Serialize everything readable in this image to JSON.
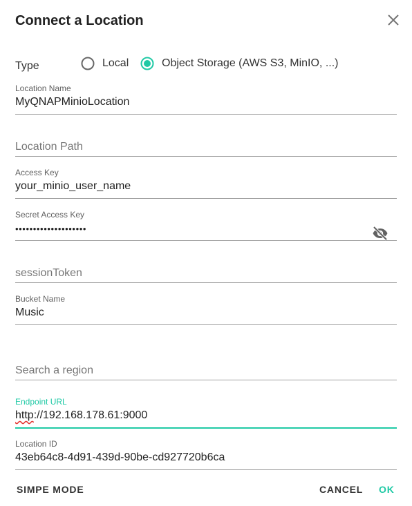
{
  "dialog": {
    "title": "Connect a Location"
  },
  "type": {
    "label": "Type",
    "options": [
      {
        "label": "Local",
        "selected": false
      },
      {
        "label": "Object Storage (AWS S3, MinIO, ...)",
        "selected": true
      }
    ]
  },
  "fields": {
    "location_name": {
      "label": "Location Name",
      "value": "MyQNAPMinioLocation"
    },
    "location_path": {
      "placeholder": "Location Path"
    },
    "access_key": {
      "label": "Access Key",
      "value": "your_minio_user_name"
    },
    "secret_access_key": {
      "label": "Secret Access Key",
      "value": "••••••••••••••••••••"
    },
    "session_token": {
      "placeholder": "sessionToken"
    },
    "bucket_name": {
      "label": "Bucket Name",
      "value": "Music"
    },
    "region": {
      "placeholder": "Search a region"
    },
    "endpoint_url": {
      "label": "Endpoint URL",
      "value_prefix": "http",
      "value_rest": "://192.168.178.61:9000"
    },
    "location_id": {
      "label": "Location ID",
      "value": "43eb64c8-4d91-439d-90be-cd927720b6ca"
    }
  },
  "buttons": {
    "simple_mode": "SIMPE MODE",
    "cancel": "CANCEL",
    "ok": "OK"
  },
  "colors": {
    "accent": "#1fc9a5",
    "underline": "#9e9e9e",
    "error_squiggle": "#e53935"
  },
  "icons": {
    "close": "close-icon",
    "visibility_off": "eye-off-icon"
  }
}
